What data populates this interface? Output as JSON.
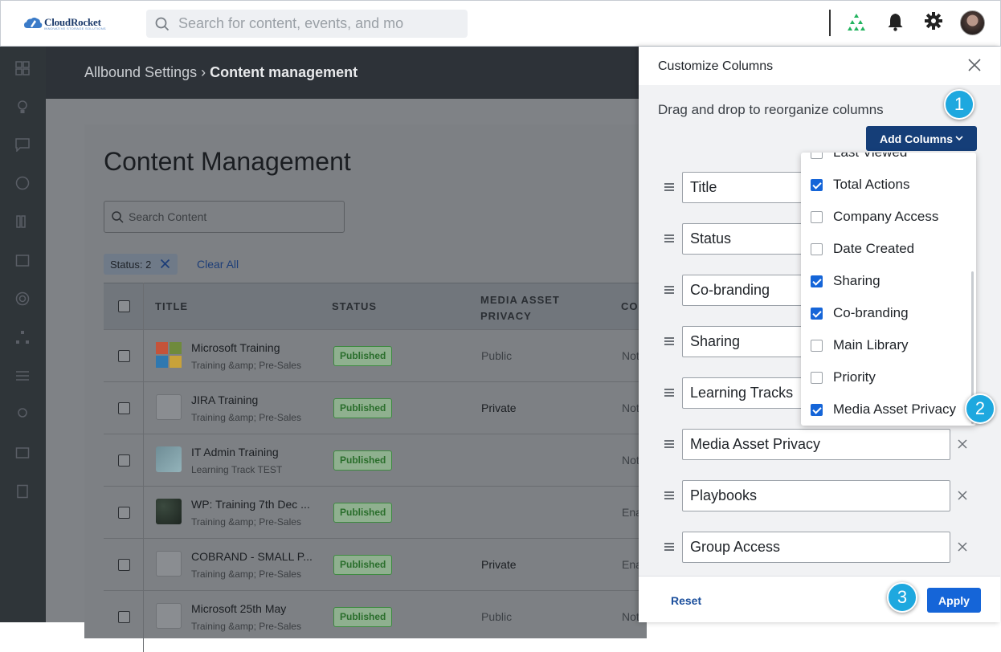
{
  "header": {
    "logo_name": "CloudRocket",
    "logo_tagline": "INNOVATIVE STORAGE SOLUTIONS",
    "search_placeholder": "Search for content, events, and mo",
    "icons": [
      "search-icon",
      "org-chart-icon",
      "bell-icon",
      "gear-icon",
      "avatar"
    ],
    "accent": "#22b35e"
  },
  "breadcrumb": {
    "parent": "Allbound Settings",
    "separator": "›",
    "current": "Content management"
  },
  "content": {
    "title": "Content Management",
    "search_placeholder": "Search Content",
    "filter_chip": "Status: 2",
    "clear_all": "Clear All",
    "columns": [
      "TITLE",
      "STATUS",
      "MEDIA ASSET PRIVACY",
      "CO"
    ],
    "rows": [
      {
        "title": "Microsoft Training",
        "subtitle": "Training &amp; Pre-Sales",
        "status": "Published",
        "privacy": "Public",
        "co": "Not",
        "thumb": "microsoft-logo"
      },
      {
        "title": "JIRA Training",
        "subtitle": "Training &amp; Pre-Sales",
        "status": "Published",
        "privacy": "Private",
        "co": "Not",
        "thumb": "placeholder"
      },
      {
        "title": "IT Admin Training",
        "subtitle": "Learning Track TEST",
        "status": "Published",
        "privacy": "",
        "co": "Not",
        "thumb": "light-blue"
      },
      {
        "title": "WP: Training 7th Dec ...",
        "subtitle": "Training &amp; Pre-Sales",
        "status": "Published",
        "privacy": "",
        "co": "Ena",
        "thumb": "dark-green"
      },
      {
        "title": "COBRAND - SMALL P...",
        "subtitle": "Training &amp; Pre-Sales",
        "status": "Published",
        "privacy": "Private",
        "co": "Ena",
        "thumb": "placeholder"
      },
      {
        "title": "Microsoft 25th May",
        "subtitle": "Training &amp; Pre-Sales",
        "status": "Published",
        "privacy": "Public",
        "co": "Not",
        "thumb": "placeholder"
      }
    ]
  },
  "panel": {
    "title": "Customize Columns",
    "hint": "Drag and drop to reorganize columns",
    "add_columns": "Add Columns",
    "columns": [
      "Title",
      "Status",
      "Co-branding",
      "Sharing",
      "Learning Tracks",
      "Media Asset Privacy",
      "Playbooks",
      "Group Access"
    ],
    "dropdown": [
      {
        "label": "Last Viewed",
        "checked": false
      },
      {
        "label": "Total Actions",
        "checked": true
      },
      {
        "label": "Company Access",
        "checked": false
      },
      {
        "label": "Date Created",
        "checked": false
      },
      {
        "label": "Sharing",
        "checked": true
      },
      {
        "label": "Co-branding",
        "checked": true
      },
      {
        "label": "Main Library",
        "checked": false
      },
      {
        "label": "Priority",
        "checked": false
      },
      {
        "label": "Media Asset Privacy",
        "checked": true
      }
    ],
    "reset": "Reset",
    "apply": "Apply"
  },
  "steps": [
    "1",
    "2",
    "3"
  ]
}
